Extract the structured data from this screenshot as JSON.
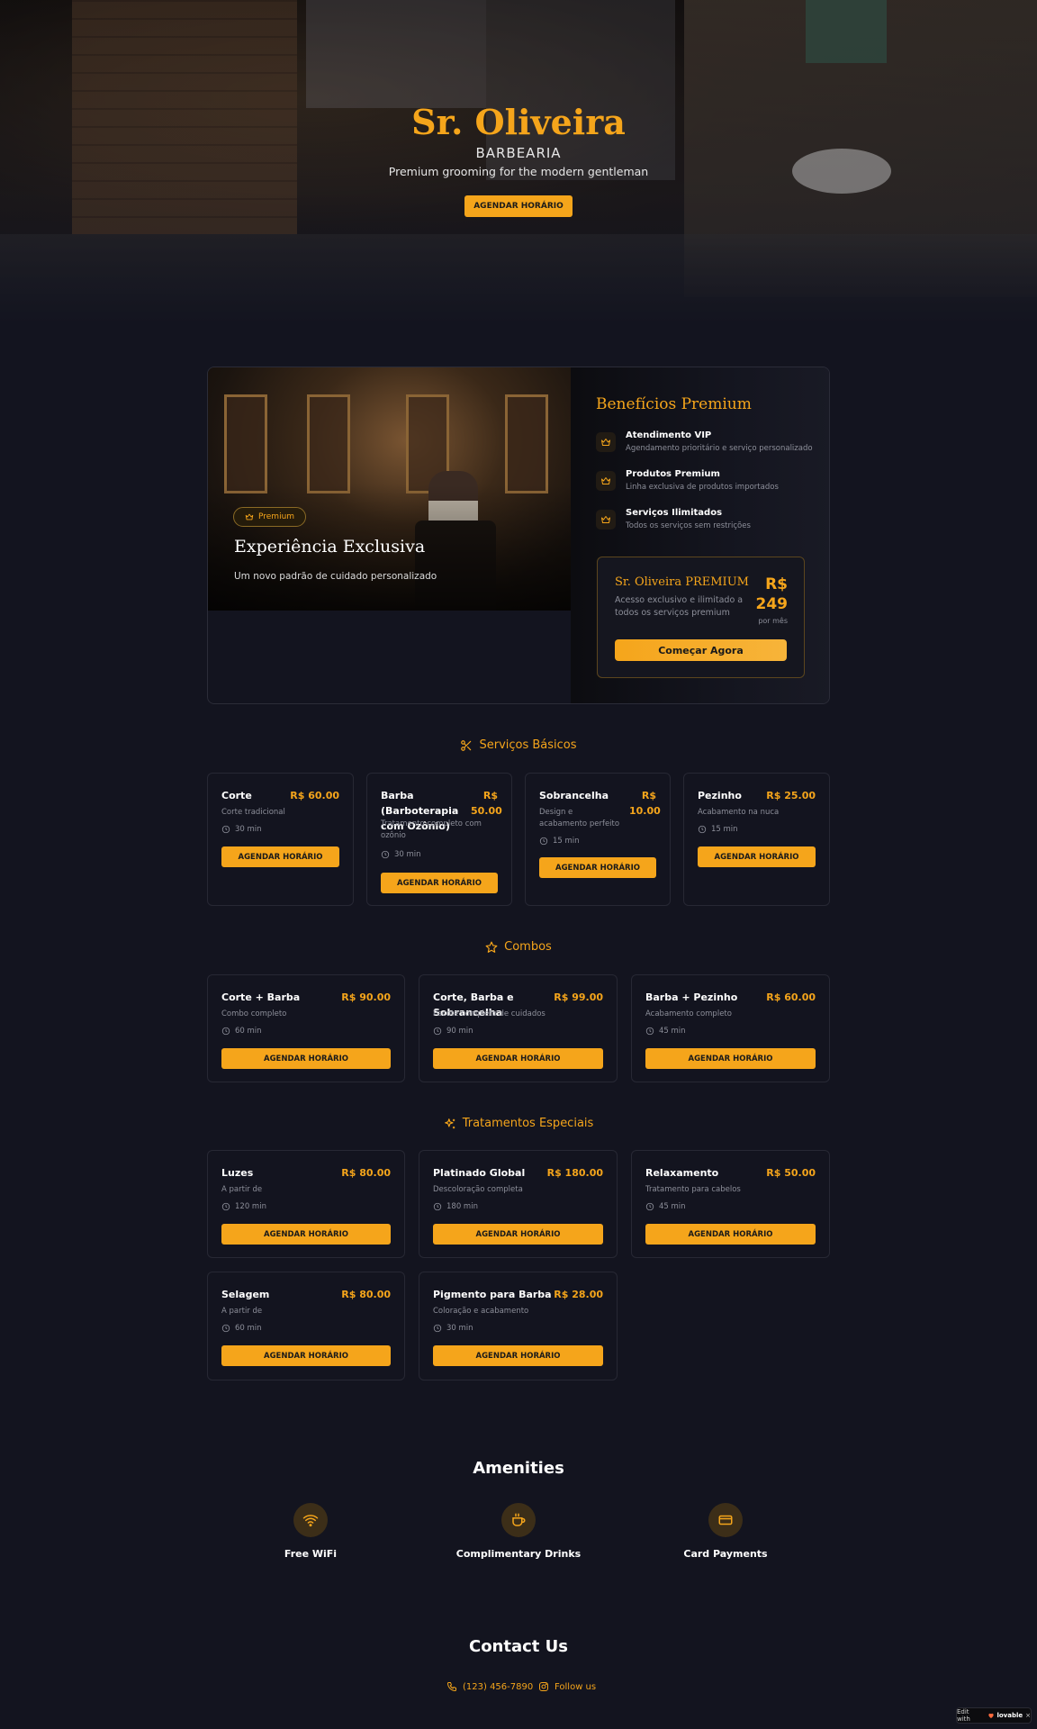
{
  "hero": {
    "title": "Sr. Oliveira",
    "subtitle": "BARBEARIA",
    "tagline": "Premium grooming for the modern gentleman",
    "cta": "AGENDAR HORÁRIO"
  },
  "premium": {
    "badge": "Premium",
    "image_title": "Experiência Exclusiva",
    "image_desc": "Um novo padrão de cuidado personalizado",
    "benefits_title": "Benefícios Premium",
    "benefits": [
      {
        "name": "Atendimento VIP",
        "text": "Agendamento prioritário e serviço personalizado",
        "icon": "crown-icon"
      },
      {
        "name": "Produtos Premium",
        "text": "Linha exclusiva de produtos importados",
        "icon": "crown-icon"
      },
      {
        "name": "Serviços Ilimitados",
        "text": "Todos os serviços sem restrições",
        "icon": "crown-icon"
      }
    ],
    "plan": {
      "name": "Sr. Oliveira PREMIUM",
      "desc": "Acesso exclusivo e ilimitado a todos os serviços premium",
      "currency": "R$",
      "price": "249",
      "period": "por mês",
      "cta": "Começar Agora"
    }
  },
  "sections": {
    "basic": {
      "title": "Serviços Básicos",
      "icon": "scissors-icon",
      "items": [
        {
          "name": "Corte",
          "price": "R$ 60.00",
          "desc": "Corte tradicional",
          "time": "30 min",
          "cta": "AGENDAR HORÁRIO"
        },
        {
          "name": "Barba (Barboterapia com Ozônio)",
          "price": "R$ 50.00",
          "desc": "Tratamento completo com ozônio",
          "time": "30 min",
          "cta": "AGENDAR HORÁRIO"
        },
        {
          "name": "Sobrancelha",
          "price": "R$ 10.00",
          "desc": "Design e acabamento perfeito",
          "time": "15 min",
          "cta": "AGENDAR HORÁRIO"
        },
        {
          "name": "Pezinho",
          "price": "R$ 25.00",
          "desc": "Acabamento na nuca",
          "time": "15 min",
          "cta": "AGENDAR HORÁRIO"
        }
      ]
    },
    "combos": {
      "title": "Combos",
      "icon": "star-icon",
      "items": [
        {
          "name": "Corte + Barba",
          "price": "R$ 90.00",
          "desc": "Combo completo",
          "time": "60 min",
          "cta": "AGENDAR HORÁRIO"
        },
        {
          "name": "Corte, Barba e Sobrancelha",
          "price": "R$ 99.00",
          "desc": "Pacote completo de cuidados",
          "time": "90 min",
          "cta": "AGENDAR HORÁRIO"
        },
        {
          "name": "Barba + Pezinho",
          "price": "R$ 60.00",
          "desc": "Acabamento completo",
          "time": "45 min",
          "cta": "AGENDAR HORÁRIO"
        }
      ]
    },
    "special": {
      "title": "Tratamentos Especiais",
      "icon": "sparkles-icon",
      "items": [
        {
          "name": "Luzes",
          "price": "R$ 80.00",
          "desc": "A partir de",
          "time": "120 min",
          "cta": "AGENDAR HORÁRIO"
        },
        {
          "name": "Platinado Global",
          "price": "R$ 180.00",
          "desc": "Descoloração completa",
          "time": "180 min",
          "cta": "AGENDAR HORÁRIO"
        },
        {
          "name": "Relaxamento",
          "price": "R$ 50.00",
          "desc": "Tratamento para cabelos",
          "time": "45 min",
          "cta": "AGENDAR HORÁRIO"
        },
        {
          "name": "Selagem",
          "price": "R$ 80.00",
          "desc": "A partir de",
          "time": "60 min",
          "cta": "AGENDAR HORÁRIO"
        },
        {
          "name": "Pigmento para Barba",
          "price": "R$ 28.00",
          "desc": "Coloração e acabamento",
          "time": "30 min",
          "cta": "AGENDAR HORÁRIO"
        }
      ]
    }
  },
  "amenities": {
    "title": "Amenities",
    "items": [
      {
        "label": "Free WiFi",
        "icon": "wifi-icon"
      },
      {
        "label": "Complimentary Drinks",
        "icon": "coffee-icon"
      },
      {
        "label": "Card Payments",
        "icon": "credit-card-icon"
      }
    ]
  },
  "contact": {
    "title": "Contact Us",
    "phone": "(123) 456-7890",
    "social": "Follow us"
  },
  "badge": {
    "prefix": "Edit with",
    "brand": "lovable",
    "close": "×"
  },
  "colors": {
    "accent": "#f5a51b",
    "background": "#13141f",
    "muted": "#8d8f9a"
  }
}
